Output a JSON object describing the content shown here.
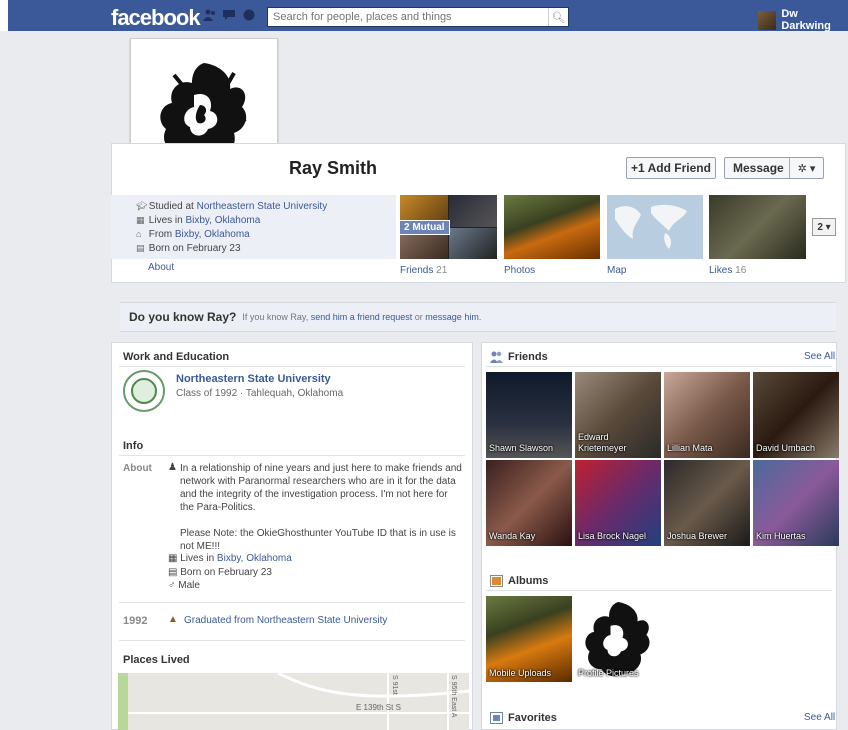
{
  "topbar": {
    "logo": "facebook",
    "search_placeholder": "Search for people, places and things",
    "user_name": "Dw Darkwing"
  },
  "profile": {
    "name": "Ray Smith",
    "add_friend": "+1 Add Friend",
    "message": "Message",
    "gear": "✲ ▾"
  },
  "info": {
    "studied_prefix": "Studied at ",
    "studied_link": "Northeastern State University",
    "lives_prefix": "Lives in ",
    "lives_link": "Bixby, Oklahoma",
    "from_prefix": "From ",
    "from_link": "Bixby, Oklahoma",
    "born": "Born on February 23",
    "about_tab": "About"
  },
  "apps": {
    "mutual": "2 Mutual",
    "friends_label": "Friends",
    "friends_count": "21",
    "photos_label": "Photos",
    "map_label": "Map",
    "likes_label": "Likes",
    "likes_count": "16",
    "more": "2 ▾"
  },
  "know": {
    "title": "Do you know Ray?",
    "text_prefix": "If you know Ray, ",
    "link1": "send him a friend request",
    "or": " or ",
    "link2": "message him",
    "end": "."
  },
  "work": {
    "title": "Work and Education",
    "school": "Northeastern State University",
    "class": "Class of 1992 · Tahlequah, Oklahoma"
  },
  "about_section": {
    "title": "Info",
    "label": "About",
    "text1": "In a relationship of nine years and just here to make friends and network with Paranormal researchers who are in it for the data and the integrity of the investigation process. I'm not here for the Para-Politics.",
    "text2": "Please Note: the OkieGhosthunter YouTube ID that is in use is not ME!!!",
    "lives_prefix": "Lives in ",
    "lives_link": "Bixby, Oklahoma",
    "born": "Born on February 23",
    "gender": "Male"
  },
  "timeline": {
    "year": "1992",
    "event": "Graduated from Northeastern State University"
  },
  "places": {
    "title": "Places Lived",
    "street1": "E 139th St S",
    "street2": "S 91st",
    "street3": "S 95th East A"
  },
  "friends_box": {
    "title": "Friends",
    "see_all": "See All",
    "items": [
      {
        "name": "Shawn Slawson"
      },
      {
        "name": "Edward Krietemeyer"
      },
      {
        "name": "Lillian Mata"
      },
      {
        "name": "David Umbach"
      },
      {
        "name": "Wanda Kay"
      },
      {
        "name": "Lisa Brock Nagel"
      },
      {
        "name": "Joshua Brewer"
      },
      {
        "name": "Kim Huertas"
      }
    ]
  },
  "albums": {
    "title": "Albums",
    "items": [
      {
        "name": "Mobile Uploads"
      },
      {
        "name": "Profile Pictures"
      }
    ]
  },
  "favorites": {
    "title": "Favorites",
    "see_all": "See All"
  },
  "colors": {
    "brand": "#3b5998",
    "link": "#3b5998"
  }
}
